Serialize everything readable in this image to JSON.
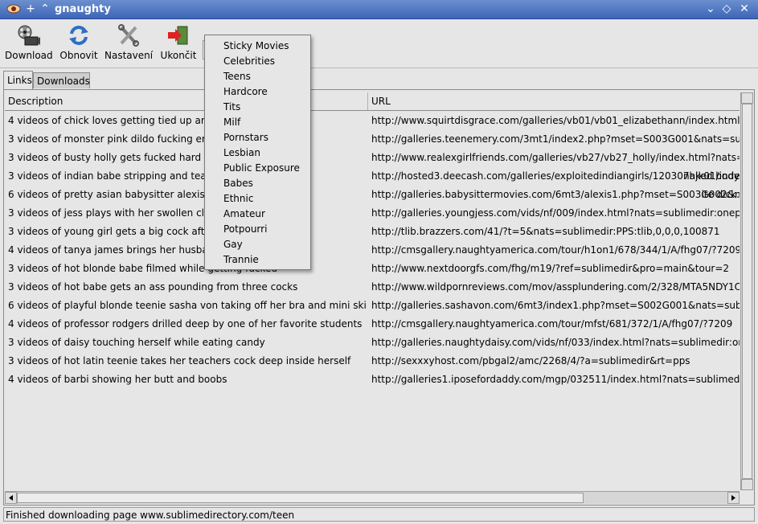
{
  "window": {
    "title": "gnaughty",
    "min_label": "⌄",
    "max_label": "◇",
    "close_label": "✕",
    "plus_label": "+",
    "arrow_label": "⌃"
  },
  "toolbar": {
    "download": "Download",
    "refresh": "Obnovit",
    "settings": "Nastavení",
    "quit": "Ukončit"
  },
  "tabs": [
    "Links",
    "Downloads"
  ],
  "table": {
    "columns": [
      "Description",
      "URL"
    ],
    "rows": [
      [
        "4 videos of chick loves getting tied up and fuc",
        "http://www.squirtdisgrace.com/galleries/vb01/vb01_elizabethann/index.html?nats=su"
      ],
      [
        "3 videos of monster pink dildo fucking emerys",
        "http://galleries.teenemery.com/3mt1/index2.php?mset=S003G001&nats=sublimedir:p"
      ],
      [
        "3 videos of busty holly gets fucked hard on a c",
        "http://www.realexgirlfriends.com/galleries/vb27/vb27_holly/index.html?nats=sublime"
      ],
      [
        "3 videos of indian babe stripping and teasing",
        "naked body",
        "http://hosted3.deecash.com/galleries/exploitedindiangirls/120307hjk01/index.html?nat"
      ],
      [
        "6 videos of pretty asian babysitter alexis strips",
        "ite dick.",
        "http://galleries.babysittermovies.com/6mt3/alexis1.php?mset=S003G002&nats=sublim"
      ],
      [
        "3 videos of jess plays with her swollen clitoris",
        "",
        "http://galleries.youngjess.com/vids/nf/009/index.html?nats=sublimedir:onepps:young"
      ],
      [
        "3 videos of young girl gets a big cock after pla",
        "",
        "http://tlib.brazzers.com/41/?t=5&nats=sublimedir:PPS:tlib,0,0,0,100871"
      ],
      [
        "4 videos of tanya james brings her husband h",
        "",
        "http://cmsgallery.naughtyamerica.com/tour/h1on1/678/344/1/A/fhg07/?7209"
      ],
      [
        "3 videos of hot blonde babe filmed while getting fucked",
        "",
        "http://www.nextdoorgfs.com/fhg/m19/?ref=sublimedir&pro=main&tour=2"
      ],
      [
        "3 videos of hot babe gets an ass pounding from three cocks",
        "",
        "http://www.wildpornreviews.com/mov/assplundering.com/2/328/MTA5NDY1OjEwOjg"
      ],
      [
        "6 videos of playful blonde teenie sasha von taking off her bra and mini skirt",
        "",
        "http://galleries.sashavon.com/6mt3/index1.php?mset=S002G001&nats=sublimedir:pp"
      ],
      [
        "4 videos of professor rodgers drilled deep by one of her favorite students",
        "",
        "http://cmsgallery.naughtyamerica.com/tour/mfst/681/372/1/A/fhg07/?7209"
      ],
      [
        "3 videos of daisy touching herself while eating candy",
        "",
        "http://galleries.naughtydaisy.com/vids/nf/033/index.html?nats=sublimedir:onepps:na"
      ],
      [
        "3 videos of hot latin teenie takes her teachers cock deep inside herself",
        "",
        "http://sexxxyhost.com/pbgal2/amc/2268/4/?a=sublimedir&rt=pps"
      ],
      [
        "4 videos of barbi showing her butt and boobs",
        "",
        "http://galleries1.iposefordaddy.com/mgp/032511/index.html?nats=sublimedir:recurring"
      ]
    ]
  },
  "menu": {
    "items": [
      "Sticky Movies",
      "Celebrities",
      "Teens",
      "Hardcore",
      "Tits",
      "Milf",
      "Pornstars",
      "Lesbian",
      "Public Exposure",
      "Babes",
      "Ethnic",
      "Amateur",
      "Potpourri",
      "Gay",
      "Trannie"
    ]
  },
  "status": {
    "text": "Finished downloading page www.sublimedirectory.com/teen"
  }
}
